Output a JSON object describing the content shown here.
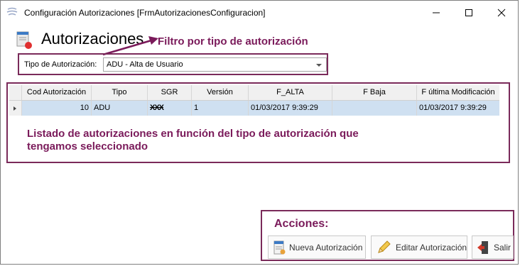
{
  "window": {
    "title": "Configuración Autorizaciones [FrmAutorizacionesConfiguracion]",
    "header": "Autorizaciones"
  },
  "filter": {
    "label": "Tipo de Autorización:",
    "selected": "ADU - Alta de Usuario"
  },
  "annotations": {
    "filter_note": "Filtro por tipo de autorización",
    "list_note_line1": "Listado de autorizaciones en función del tipo de autorización que",
    "list_note_line2": "tengamos seleccionado",
    "actions_title": "Acciones:"
  },
  "grid": {
    "columns": [
      "Cod Autorización",
      "Tipo",
      "SGR",
      "Versión",
      "F_ALTA",
      "F Baja",
      "F última Modificación"
    ],
    "rows": [
      {
        "cod": "10",
        "tipo": "ADU",
        "sgr": "XXX",
        "version": "1",
        "f_alta": "01/03/2017 9:39:29",
        "f_baja": "",
        "f_mod": "01/03/2017 9:39:29"
      }
    ]
  },
  "actions": {
    "new": "Nueva Autorización",
    "edit": "Editar Autorización",
    "exit": "Salir"
  },
  "colors": {
    "annotation": "#7a1a5a",
    "selected_row": "#cfe0f1"
  }
}
